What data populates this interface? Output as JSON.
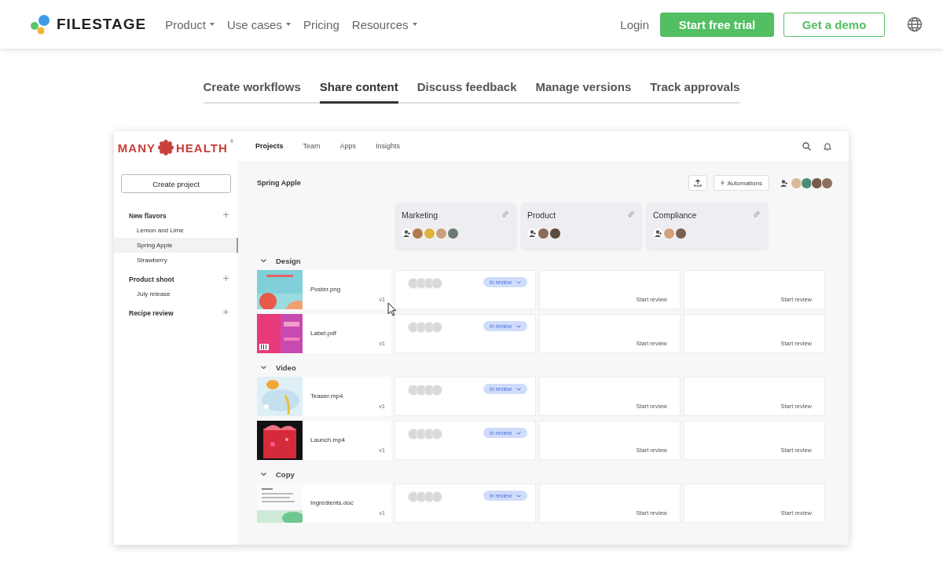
{
  "header": {
    "brand": "FILESTAGE",
    "nav": [
      {
        "label": "Product",
        "dropdown": true
      },
      {
        "label": "Use cases",
        "dropdown": true
      },
      {
        "label": "Pricing",
        "dropdown": false
      },
      {
        "label": "Resources",
        "dropdown": true
      }
    ],
    "login": "Login",
    "trial": "Start free trial",
    "demo": "Get a demo"
  },
  "feature_tabs": [
    {
      "label": "Create workflows",
      "selected": false
    },
    {
      "label": "Share content",
      "selected": true
    },
    {
      "label": "Discuss feedback",
      "selected": false
    },
    {
      "label": "Manage versions",
      "selected": false
    },
    {
      "label": "Track approvals",
      "selected": false
    }
  ],
  "app": {
    "brand": {
      "left": "MANY",
      "right": "HEALTH",
      "mark": "®"
    },
    "create_button": "Create project",
    "sidebar": [
      {
        "label": "New flavors",
        "children": [
          {
            "label": "Lemon and Lime",
            "selected": false
          },
          {
            "label": "Spring Apple",
            "selected": true
          },
          {
            "label": "Strawberry",
            "selected": false
          }
        ]
      },
      {
        "label": "Product shoot",
        "children": [
          {
            "label": "July release",
            "selected": false
          }
        ]
      },
      {
        "label": "Recipe review"
      }
    ],
    "tabs": [
      {
        "label": "Projects",
        "selected": true
      },
      {
        "label": "Team",
        "selected": false
      },
      {
        "label": "Apps",
        "selected": false
      },
      {
        "label": "Insights",
        "selected": false
      }
    ],
    "project_title": "Spring Apple",
    "automations": "Automations",
    "team": [
      {
        "color": "#d9b89a"
      },
      {
        "color": "#4a8c7a"
      },
      {
        "color": "#7a5a48"
      },
      {
        "color": "#8c7060"
      }
    ],
    "columns": [
      {
        "name": "Marketing",
        "members": [
          {
            "color": "#b07a50"
          },
          {
            "color": "#e0b040"
          },
          {
            "color": "#c8a080"
          },
          {
            "color": "#6a7a70"
          }
        ]
      },
      {
        "name": "Product",
        "members": [
          {
            "color": "#8a6a58"
          },
          {
            "color": "#5a4a40"
          }
        ]
      },
      {
        "name": "Compliance",
        "members": [
          {
            "color": "#d0a080"
          },
          {
            "color": "#7a6050"
          }
        ]
      }
    ],
    "sections": [
      {
        "name": "Design",
        "files": [
          {
            "name": "Poster.png",
            "version": "v1",
            "status": "In review",
            "reviews": [
              "Start review",
              "Start review"
            ]
          },
          {
            "name": "Label.pdf",
            "version": "v1",
            "status": "In review",
            "reviews": [
              "Start review",
              "Start review"
            ]
          }
        ]
      },
      {
        "name": "Video",
        "files": [
          {
            "name": "Teaser.mp4",
            "version": "v1",
            "status": "In review",
            "reviews": [
              "Start review",
              "Start review"
            ]
          },
          {
            "name": "Launch.mp4",
            "version": "v1",
            "status": "In review",
            "reviews": [
              "Start review",
              "Start review"
            ]
          }
        ]
      },
      {
        "name": "Copy",
        "files": [
          {
            "name": "Ingredients.doc",
            "version": "v1",
            "status": "In review",
            "reviews": [
              "Start review",
              "Start review"
            ]
          }
        ]
      }
    ]
  }
}
